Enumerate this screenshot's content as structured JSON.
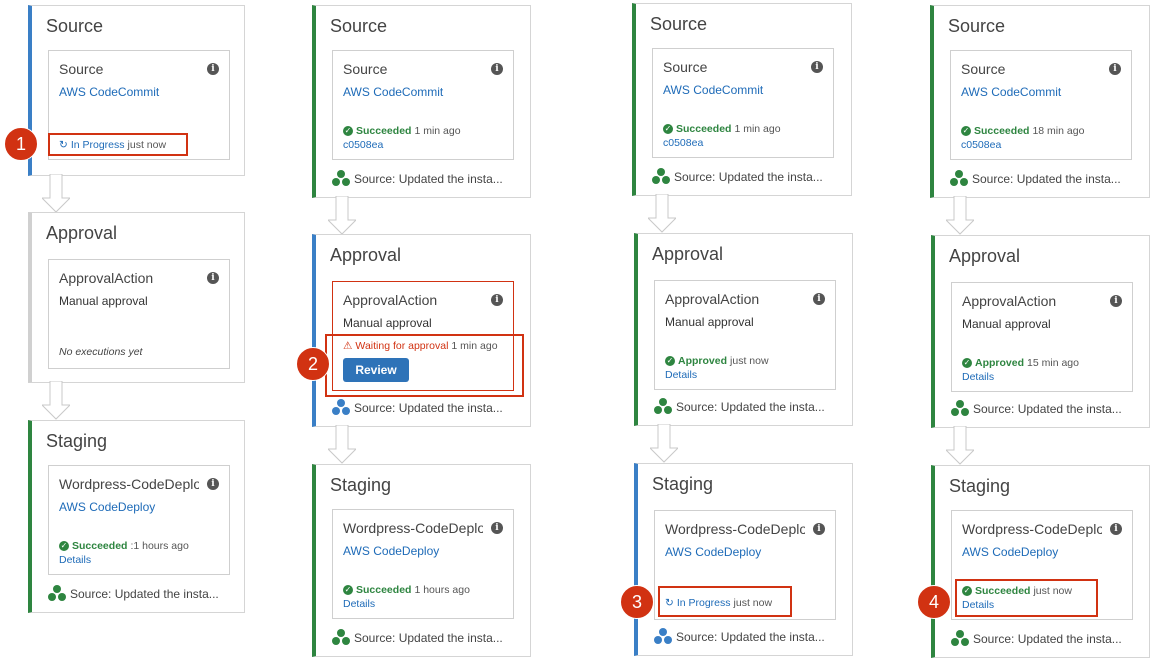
{
  "source_stage": {
    "title": "Source",
    "action_name": "Source",
    "provider": "AWS CodeCommit"
  },
  "approval_stage": {
    "title": "Approval",
    "action_name": "ApprovalAction",
    "provider": "Manual approval"
  },
  "staging_stage": {
    "title": "Staging",
    "action_name": "Wordpress-CodeDeplo...",
    "provider": "AWS CodeDeploy"
  },
  "info_glyph": "i",
  "commit_id": "c0508ea",
  "details_link": "Details",
  "revision_footer": "Source: Updated the insta...",
  "status": {
    "in_progress": "In Progress",
    "succeeded": "Succeeded",
    "approved": "Approved",
    "waiting": "Waiting for approval",
    "no_executions": "No executions yet"
  },
  "times": {
    "just_now": "just now",
    "one_min": "1 min ago",
    "eighteen_min": "18 min ago",
    "fifteen_min": "15 min ago",
    "one_hour": "1 hours ago",
    "one_hour_alt": ":1 hours ago"
  },
  "review_button": "Review",
  "step_markers": [
    "1",
    "2",
    "3",
    "4"
  ],
  "colors": {
    "success": "#2e8540",
    "in_progress": "#3a7fc6",
    "warning": "#d13212",
    "link": "#1e6bb8"
  }
}
